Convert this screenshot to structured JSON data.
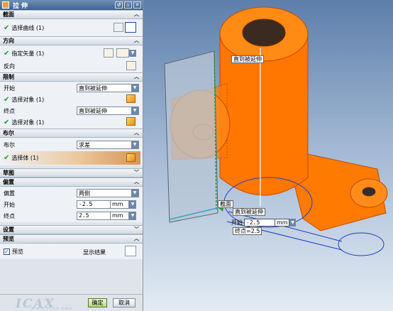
{
  "dialog": {
    "title": "拉伸",
    "sections": {
      "section": {
        "title": "截面",
        "select_curve": "选择曲线 (1)"
      },
      "direction": {
        "title": "方向",
        "specify_vector": "指定矢量 (1)",
        "reverse": "反向"
      },
      "limits": {
        "title": "限制",
        "start_label": "开始",
        "start_value": "直到被延伸",
        "start_select": "选择对象 (1)",
        "end_label": "终点",
        "end_value": "直到被延伸",
        "end_select": "选择对象 (1)"
      },
      "boolean": {
        "title": "布尔",
        "bool_label": "布尔",
        "bool_value": "求差",
        "select_body": "选择体 (1)"
      },
      "draft": {
        "title": "草图"
      },
      "offset": {
        "title": "偏置",
        "offset_label": "偏置",
        "offset_value": "两侧",
        "start_label": "开始",
        "start_value": "-2.5",
        "start_unit": "mm",
        "end_label": "终点",
        "end_value": "2.5",
        "end_unit": "mm"
      },
      "settings": {
        "title": "设置"
      },
      "preview": {
        "title": "预览",
        "preview_check": "预览",
        "show_result": "显示结果"
      }
    },
    "ok_label": "确定",
    "cancel_label": "取消"
  },
  "watermark": {
    "logo": "ICAX",
    "url": "WWW.ICAX.ORG"
  },
  "viewport": {
    "tag_top": "直到被延伸",
    "tag_section": "截面",
    "tag_bottom": "直到被延伸",
    "start_label": "开始",
    "start_value": "-2.5",
    "start_unit": "mm",
    "end_readout": "终点=2.5"
  },
  "colors": {
    "body": "#ff7a00",
    "edge": "#d35400",
    "plane": "#b9c7d6",
    "axis": "#1f3fc4",
    "section": "#2e9a3a"
  }
}
